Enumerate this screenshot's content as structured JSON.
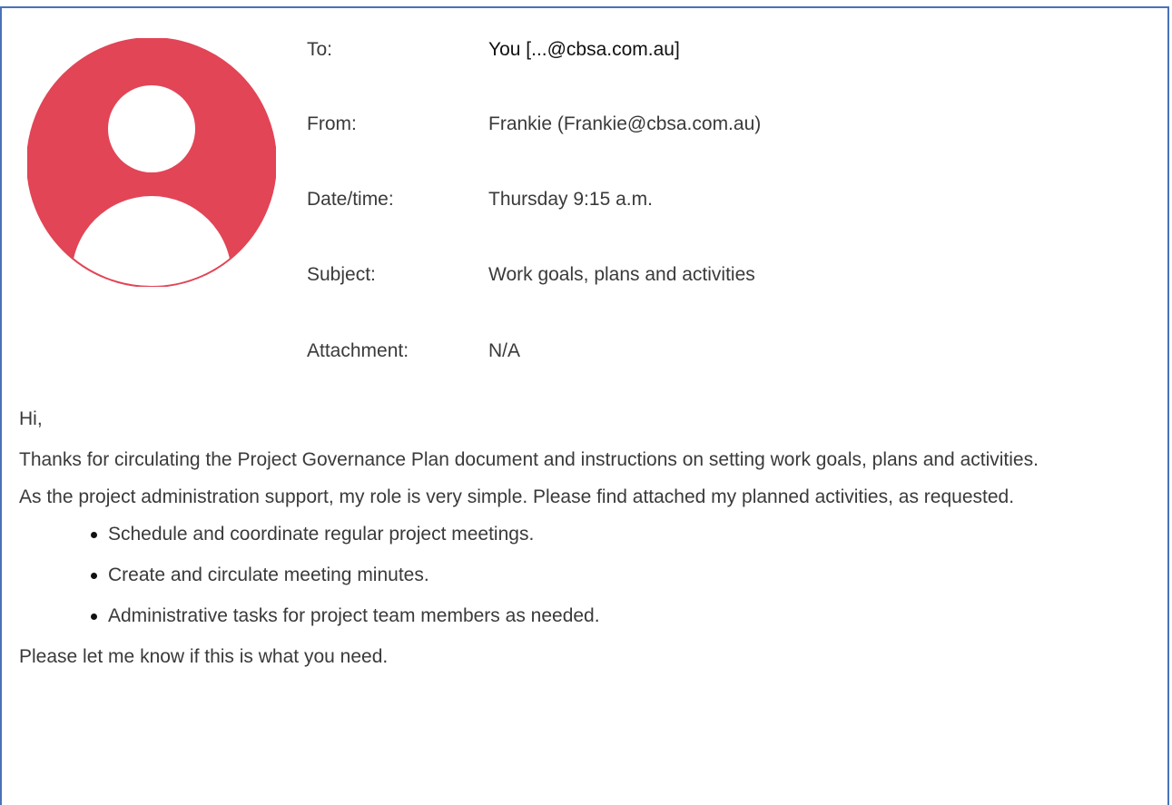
{
  "header": {
    "fields": [
      {
        "label": "To:",
        "value": "You [...@cbsa.com.au]"
      },
      {
        "label": "From:",
        "value": "Frankie (Frankie@cbsa.com.au)"
      },
      {
        "label": "Date/time:",
        "value": "Thursday 9:15 a.m."
      },
      {
        "label": "Subject:",
        "value": "Work goals, plans and activities"
      },
      {
        "label": "Attachment:",
        "value": "N/A"
      }
    ]
  },
  "avatar": {
    "icon": "user-avatar-icon",
    "color": "#e24556"
  },
  "message": {
    "greeting": "Hi,",
    "paragraph1": "Thanks for circulating the Project Governance Plan document and instructions on setting work goals, plans and activities.",
    "paragraph2": "As the project administration support, my role is very simple. Please find attached my planned activities, as requested.",
    "tasks": [
      "Schedule and coordinate regular project meetings.",
      "Create and circulate meeting minutes.",
      "Administrative tasks for project team members as needed."
    ],
    "closing": "Please let me know if this is what you need."
  },
  "colors": {
    "border": "#4a72b8",
    "text": "#3a3a3a"
  }
}
